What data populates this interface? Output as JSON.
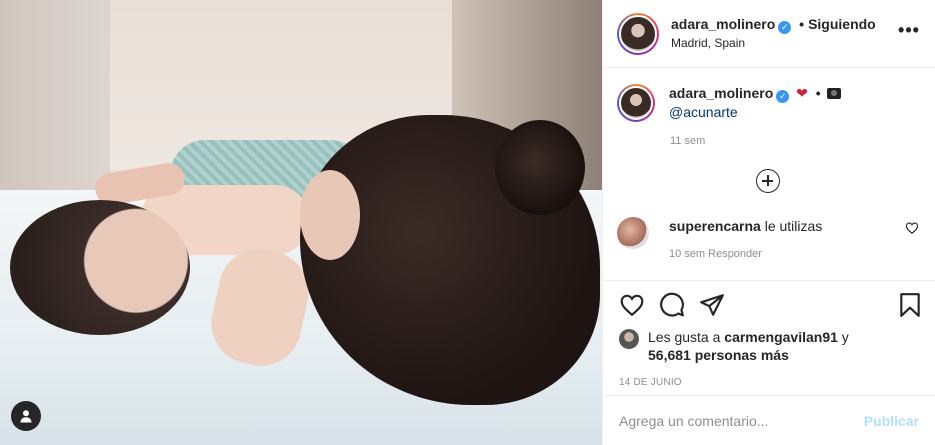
{
  "header": {
    "username": "adara_molinero",
    "separator": "•",
    "following_label": "Siguiendo",
    "location": "Madrid, Spain",
    "more_label": "•••"
  },
  "caption": {
    "username": "adara_molinero",
    "emoji_heart": "❤",
    "separator": "•",
    "mention": "@acunarte",
    "time": "11 sem"
  },
  "comments": [
    {
      "username": "superencarna",
      "text": "le utilizas",
      "meta": "10 sem   Responder"
    }
  ],
  "likes": {
    "prefix": "Les gusta a",
    "user": "carmengavilan91",
    "connector": "y",
    "others": "56,681 personas más"
  },
  "date": "14 DE JUNIO",
  "composer": {
    "placeholder": "Agrega un comentario...",
    "publish_label": "Publicar"
  },
  "colors": {
    "verified": "#3897f0",
    "publish_disabled": "#b2dffc",
    "muted": "#8e8e8e"
  },
  "icons": {
    "user_tag": "user-tag-icon",
    "more": "more-options-icon",
    "load_more": "plus-circle-icon",
    "like": "heart-icon",
    "comment": "comment-icon",
    "share": "paper-plane-icon",
    "save": "bookmark-icon"
  }
}
